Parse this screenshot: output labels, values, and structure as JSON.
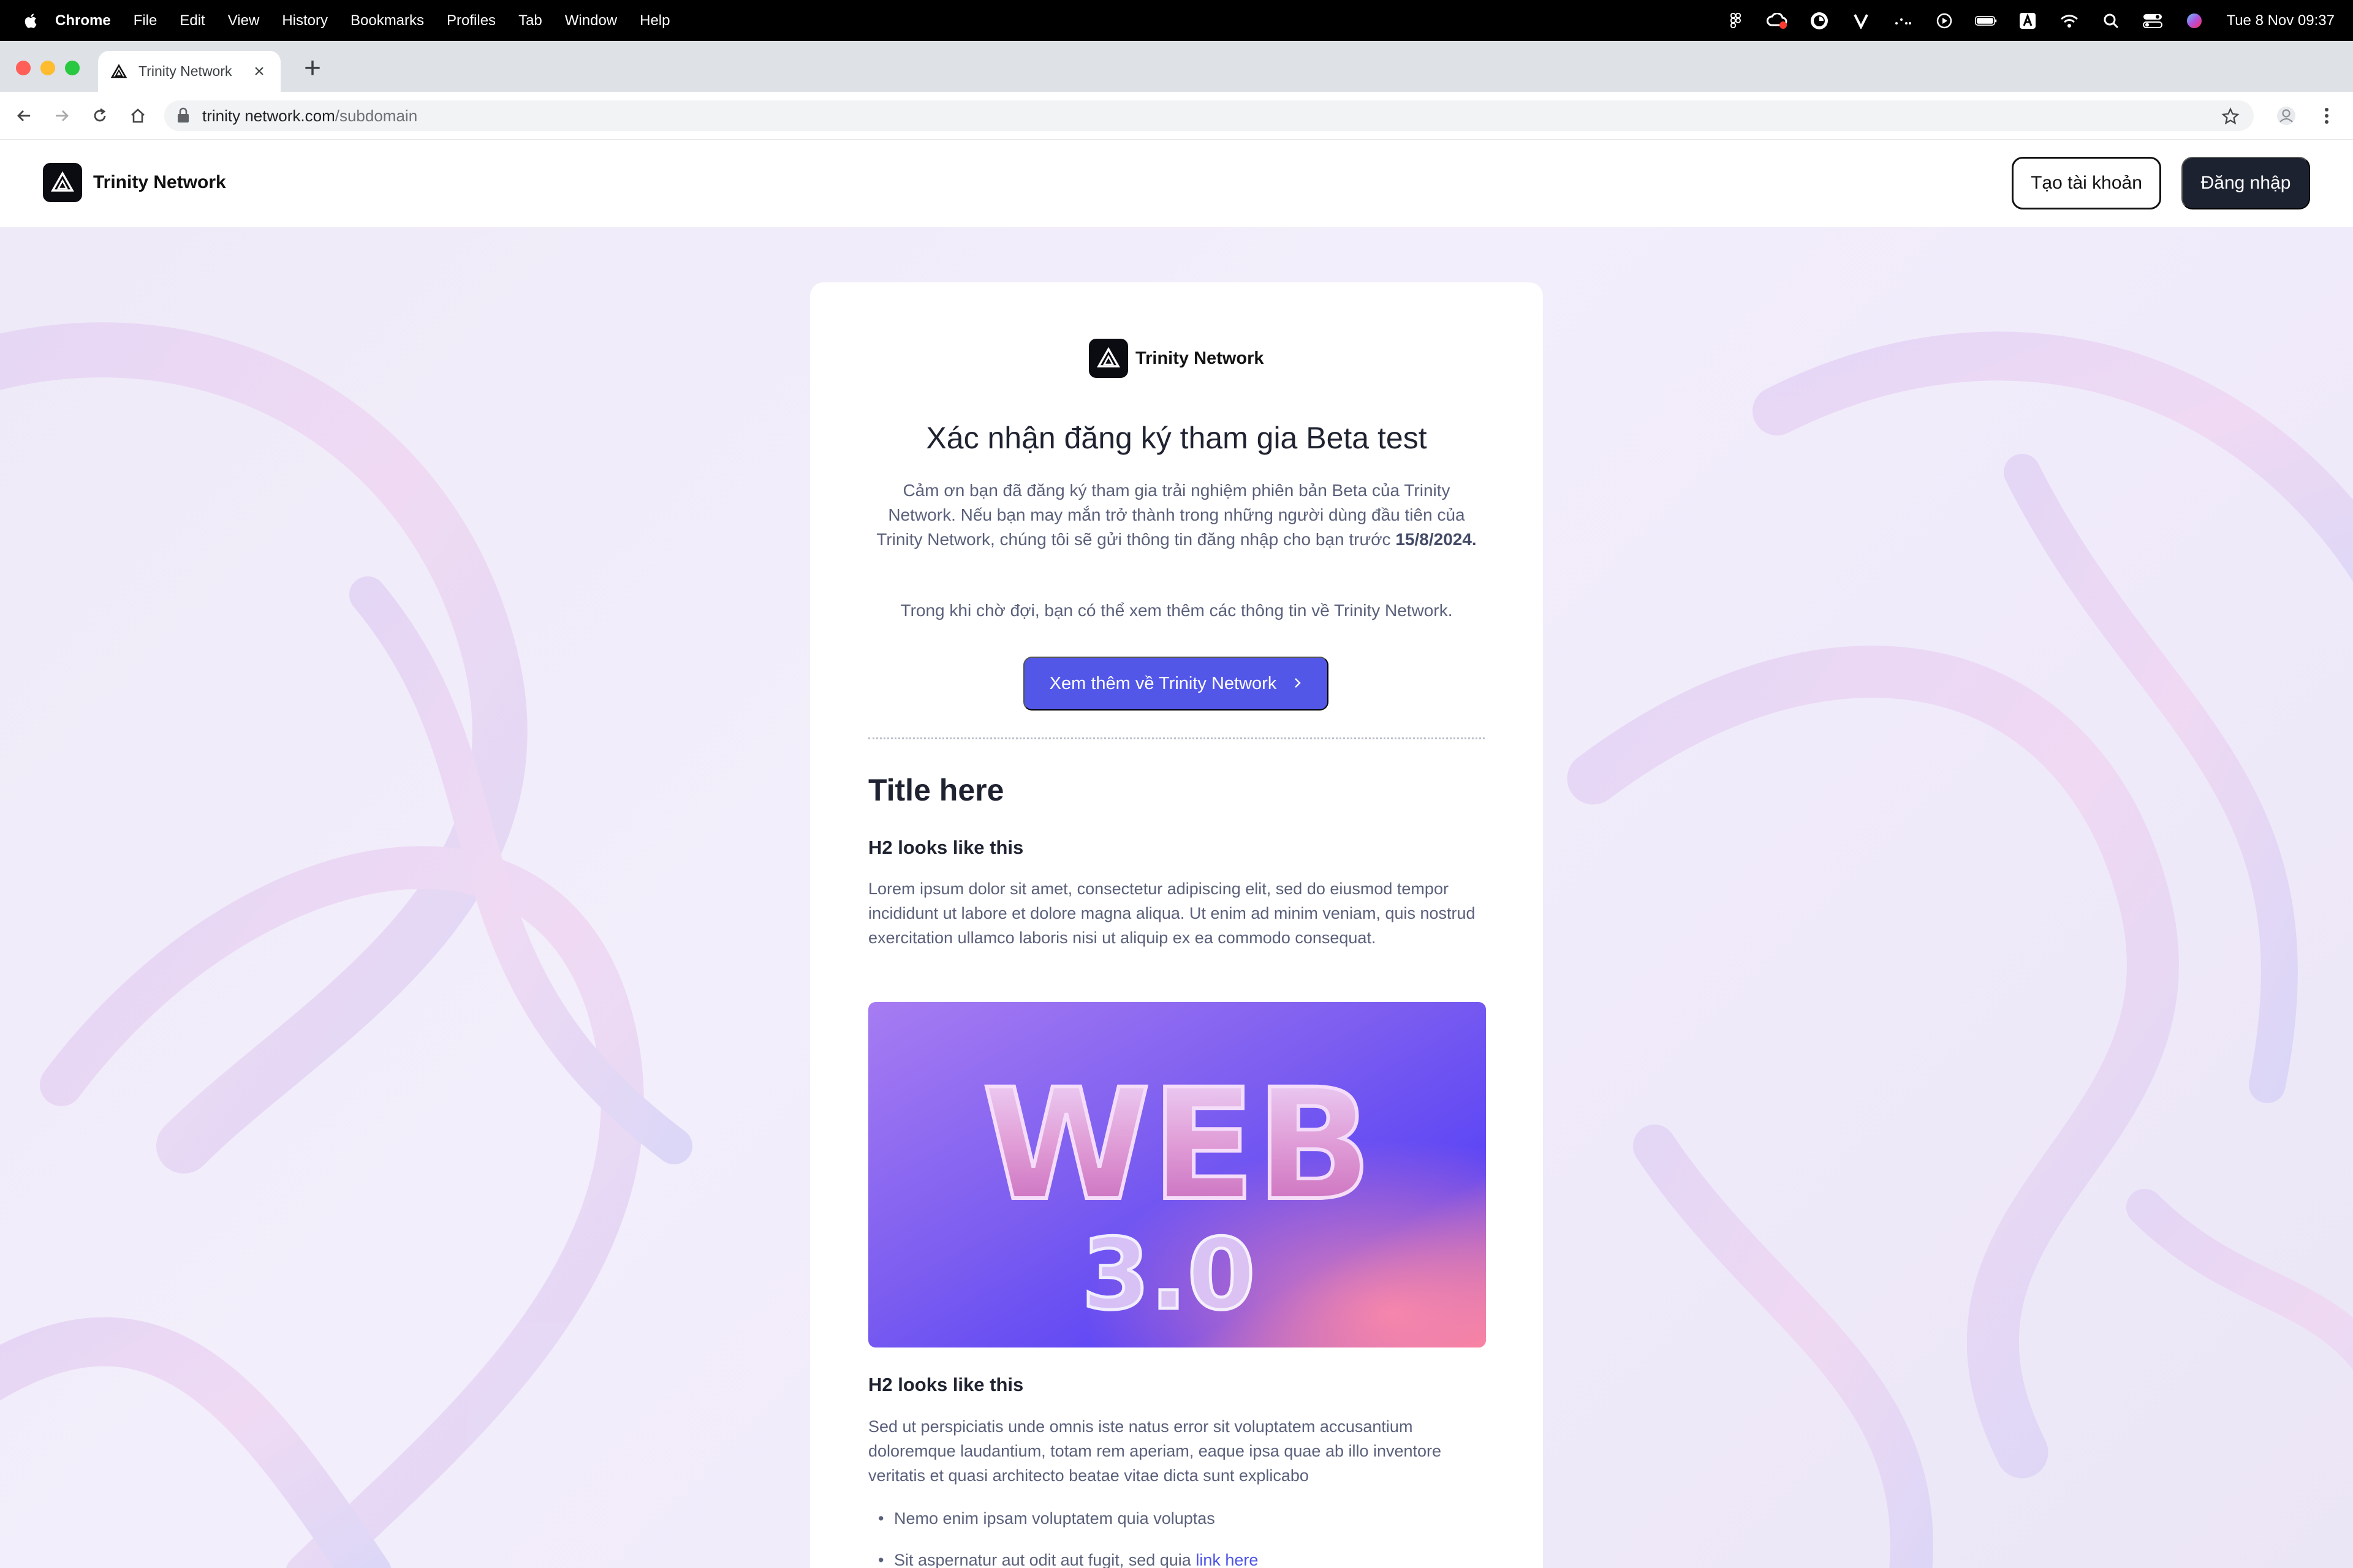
{
  "menubar": {
    "app": "Chrome",
    "items": [
      "File",
      "Edit",
      "View",
      "History",
      "Bookmarks",
      "Profiles",
      "Tab",
      "Window",
      "Help"
    ],
    "clock": "Tue 8 Nov  09:37",
    "status_icons": [
      "figma-icon",
      "creative-cloud-icon",
      "timer-icon",
      "vectorworks-icon",
      "dots-icon",
      "play-icon",
      "battery-icon",
      "keyboard-a-icon",
      "wifi-icon",
      "search-icon",
      "control-center-icon",
      "siri-icon"
    ]
  },
  "browser": {
    "tab_title": "Trinity Network",
    "url_host": "trinity network.com",
    "url_path": "/subdomain"
  },
  "header": {
    "brand": "Trinity Network",
    "signup_label": "Tạo tài khoản",
    "login_label": "Đăng nhập"
  },
  "card": {
    "brand": "Trinity Network",
    "title": "Xác nhận đăng ký tham gia Beta test",
    "intro": "Cảm ơn bạn đã đăng ký tham gia trải nghiệm phiên bản Beta của Trinity Network. Nếu bạn may mắn trở thành trong những người dùng đầu tiên của Trinity Network, chúng tôi sẽ gửi thông tin đăng nhập cho bạn trước ",
    "intro_date": "15/8/2024.",
    "wait_text": "Trong khi chờ đợi, bạn có thể xem thêm các thông tin về Trinity Network.",
    "cta_label": "Xem thêm về Trinity Network",
    "section_title": "Title here",
    "h2_first": "H2 looks like this",
    "para_first": "Lorem ipsum dolor sit amet, consectetur adipiscing elit, sed do eiusmod tempor incididunt ut labore et dolore magna aliqua. Ut enim ad minim veniam, quis nostrud exercitation ullamco laboris nisi ut aliquip ex ea commodo consequat.",
    "hero_text_main": "WEB",
    "hero_text_sub": "3.0",
    "h2_second": "H2 looks like this",
    "para_second": "Sed ut perspiciatis unde omnis iste natus error sit voluptatem accusantium doloremque laudantium, totam rem aperiam, eaque ipsa quae ab illo inventore veritatis et quasi architecto beatae vitae dicta sunt explicabo",
    "bullets": [
      "Nemo enim ipsam voluptatem quia voluptas",
      "Sit aspernatur aut odit aut fugit, sed quia "
    ],
    "bullet_link": "link here"
  },
  "colors": {
    "accent": "#5257e8",
    "dark_button": "#1d2230",
    "text_body": "#5a607a",
    "heading": "#1f2230"
  }
}
